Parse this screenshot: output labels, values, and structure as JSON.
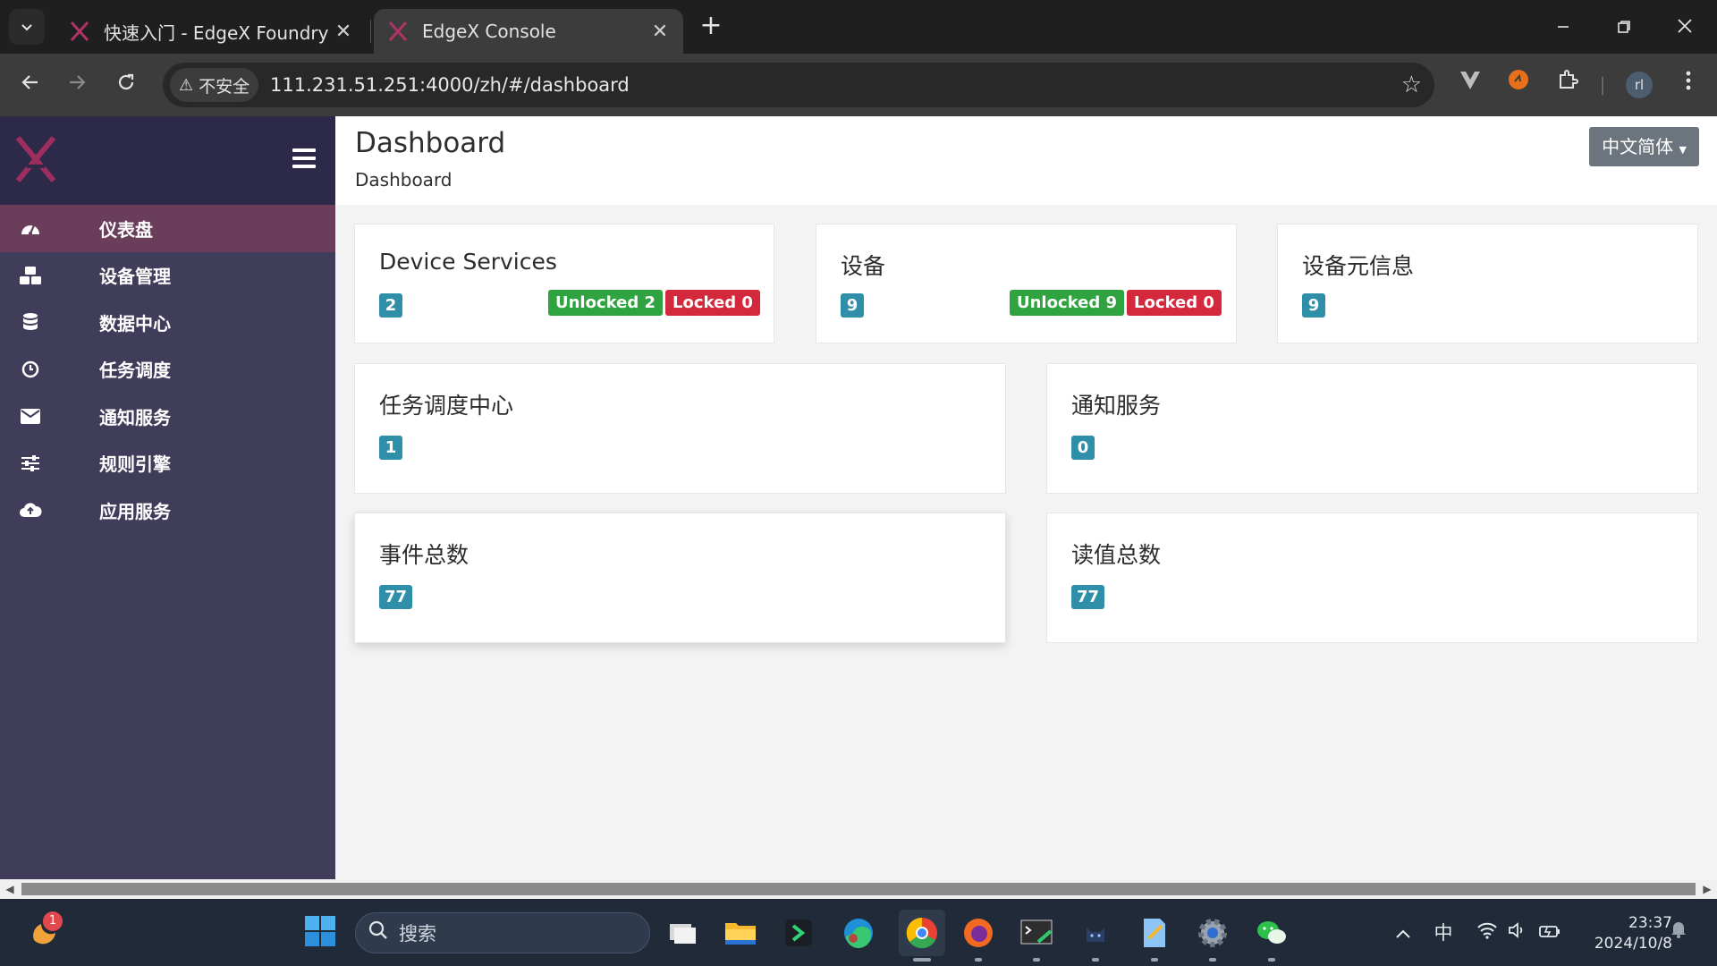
{
  "browser": {
    "tabs": [
      {
        "title": "快速入门 - EdgeX Foundry 文档",
        "active": false
      },
      {
        "title": "EdgeX Console",
        "active": true
      }
    ],
    "security_label": "不安全",
    "url": "111.231.51.251:4000/zh/#/dashboard",
    "profile_initials": "rl"
  },
  "sidebar": {
    "items": [
      {
        "label": "仪表盘",
        "icon": "dashboard-icon",
        "active": true
      },
      {
        "label": "设备管理",
        "icon": "cubes-icon",
        "active": false
      },
      {
        "label": "数据中心",
        "icon": "database-icon",
        "active": false
      },
      {
        "label": "任务调度",
        "icon": "clock-icon",
        "active": false
      },
      {
        "label": "通知服务",
        "icon": "envelope-icon",
        "active": false
      },
      {
        "label": "规则引擎",
        "icon": "sliders-icon",
        "active": false
      },
      {
        "label": "应用服务",
        "icon": "cloud-upload-icon",
        "active": false
      }
    ]
  },
  "header": {
    "title": "Dashboard",
    "breadcrumb": "Dashboard",
    "language": "中文简体"
  },
  "cards": {
    "device_services": {
      "title": "Device Services",
      "count": "2",
      "unlocked": "Unlocked 2",
      "locked": "Locked 0"
    },
    "devices": {
      "title": "设备",
      "count": "9",
      "unlocked": "Unlocked 9",
      "locked": "Locked 0"
    },
    "device_profiles": {
      "title": "设备元信息",
      "count": "9"
    },
    "scheduler": {
      "title": "任务调度中心",
      "count": "1"
    },
    "notifications": {
      "title": "通知服务",
      "count": "0"
    },
    "events": {
      "title": "事件总数",
      "count": "77"
    },
    "readings": {
      "title": "读值总数",
      "count": "77"
    }
  },
  "taskbar": {
    "search_placeholder": "搜索",
    "notification_badge": "1",
    "ime": "中",
    "time": "23:37",
    "date": "2024/10/8"
  },
  "colors": {
    "sidebar_bg": "#3f3d5a",
    "sidebar_active": "#6a3e5b",
    "count_badge": "#2f8fa8",
    "unlocked_green": "#2fa33f",
    "locked_red": "#d4283c"
  }
}
